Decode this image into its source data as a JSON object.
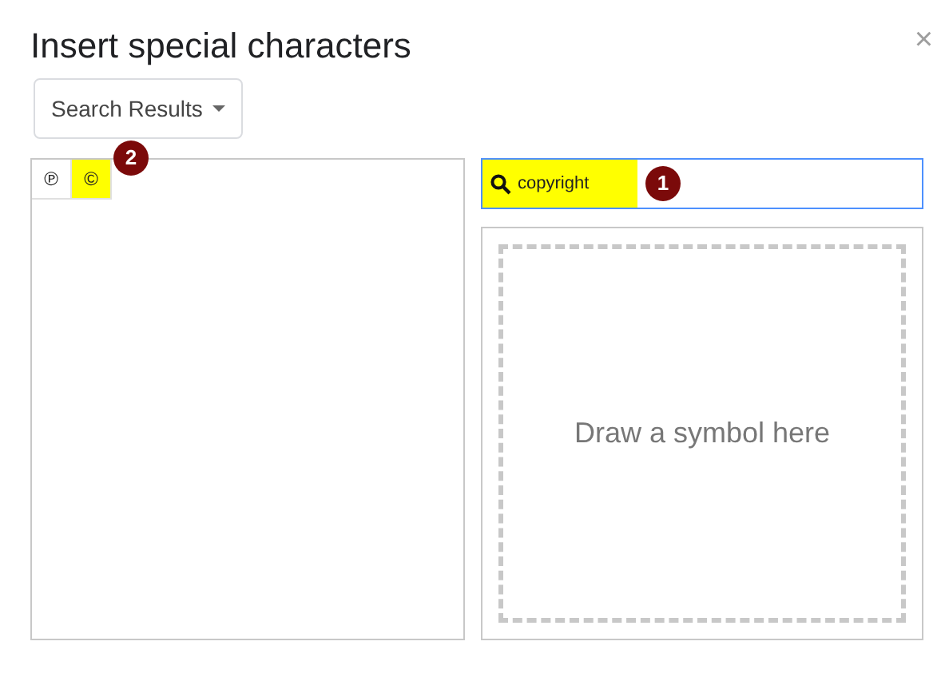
{
  "window": {
    "title": "Insert special characters",
    "close": "×"
  },
  "category_dropdown": {
    "label": "Search Results"
  },
  "symbols": [
    {
      "char": "℗",
      "highlighted": false
    },
    {
      "char": "©",
      "highlighted": true,
      "badge": "2"
    }
  ],
  "search": {
    "value": "copyright",
    "highlighted": true,
    "badge": "1"
  },
  "draw_area": {
    "placeholder": "Draw a symbol here"
  }
}
